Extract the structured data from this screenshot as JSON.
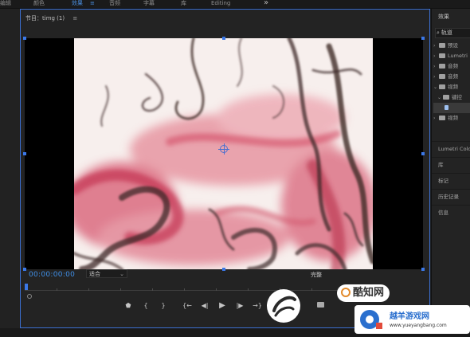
{
  "topbar": {
    "tabs": [
      {
        "label": "编辑",
        "active": false
      },
      {
        "label": "颜色",
        "active": false
      },
      {
        "label": "效果",
        "active": true
      },
      {
        "label": "音频",
        "active": false
      },
      {
        "label": "字幕",
        "active": false
      },
      {
        "label": "库",
        "active": false
      },
      {
        "label": "Editing",
        "active": false
      }
    ],
    "more": "»"
  },
  "program": {
    "title": "节目：timg (1)",
    "menu": "≡",
    "timecode": "00:00:00:00",
    "fit": "适合",
    "quality": "完整"
  },
  "controls": {
    "marker": "⬟",
    "in": "{",
    "out": "}",
    "goto_in": "{←",
    "step_back": "◀|",
    "play": "▶",
    "step_fwd": "|▶",
    "goto_out": "→}"
  },
  "effects_panel": {
    "title": "效果",
    "search": "轨道",
    "tree": [
      {
        "label": "预设",
        "level": 0,
        "expanded": false
      },
      {
        "label": "Lumetri",
        "level": 0,
        "expanded": false
      },
      {
        "label": "音频",
        "level": 0,
        "expanded": false
      },
      {
        "label": "音频",
        "level": 0,
        "expanded": false
      },
      {
        "label": "视频",
        "level": 0,
        "expanded": true
      },
      {
        "label": "键控",
        "level": 1,
        "expanded": true
      },
      {
        "label": "",
        "level": 2,
        "selected": true
      },
      {
        "label": "视频",
        "level": 0,
        "expanded": false
      }
    ],
    "sections": [
      "Lumetri Color",
      "库",
      "标记",
      "历史记录",
      "信息"
    ]
  },
  "watermark": {
    "badge": "酷知网",
    "site_cn": "越羊游戏网",
    "url": "www.yueyangbang.com"
  },
  "colors": {
    "accent": "#3b78e7",
    "timecode": "#3f8fe8",
    "panel": "#232323"
  }
}
